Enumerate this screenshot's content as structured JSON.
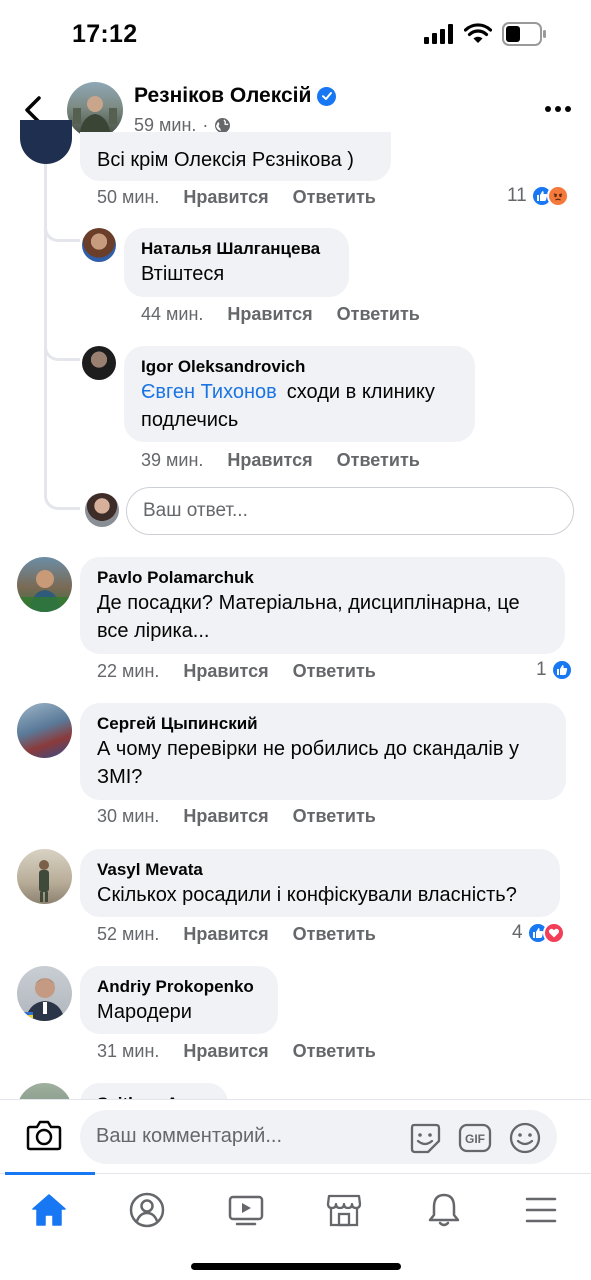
{
  "status_bar": {
    "time": "17:12"
  },
  "header": {
    "name": "Резніков Олексій",
    "time_ago": "59 мин.",
    "separator": "·"
  },
  "comments": [
    {
      "text": "Всі крім Олексія Рєзнікова )",
      "time": "50 мин.",
      "like_label": "Нравится",
      "reply_label": "Ответить",
      "reaction_count": "11",
      "reactions": [
        "like",
        "angry"
      ]
    },
    {
      "author": "Наталья Шалганцева",
      "text": "Втіштеся",
      "time": "44 мин.",
      "like_label": "Нравится",
      "reply_label": "Ответить"
    },
    {
      "author": "Igor Oleksandrovich",
      "mention": "Євген Тихонов",
      "text_line1": "сходи в клинику",
      "text_line2": "подлечись",
      "time": "39 мин.",
      "like_label": "Нравится",
      "reply_label": "Ответить"
    },
    {
      "author": "Pavlo Polamarchuk",
      "text_line1": "Де посадки? Матеріальна, дисциплінарна, це",
      "text_line2": "все лірика...",
      "time": "22 мин.",
      "like_label": "Нравится",
      "reply_label": "Ответить",
      "reaction_count": "1",
      "reactions": [
        "like"
      ]
    },
    {
      "author": "Сергей Цыпинский",
      "text_line1": "А чому перевірки не робились до скандалів у",
      "text_line2": "ЗМІ?",
      "time": "30 мин.",
      "like_label": "Нравится",
      "reply_label": "Ответить"
    },
    {
      "author": "Vasyl Mevata",
      "text": "Скількох росадили і конфіскували власність?",
      "time": "52 мин.",
      "like_label": "Нравится",
      "reply_label": "Ответить",
      "reaction_count": "4",
      "reactions": [
        "like",
        "love"
      ]
    },
    {
      "author": "Andriy Prokopenko",
      "text": "Мародери",
      "time": "31 мин.",
      "like_label": "Нравится",
      "reply_label": "Ответить"
    },
    {
      "author": "Svitlana A..."
    }
  ],
  "reply_input": {
    "placeholder": "Ваш ответ..."
  },
  "composer": {
    "placeholder": "Ваш комментарий..."
  },
  "tabs": [
    "home-icon",
    "profile-icon",
    "video-icon",
    "marketplace-icon",
    "notifications-icon",
    "menu-icon"
  ],
  "colors": {
    "accent": "#1877f2",
    "bubble": "#f0f2f5",
    "meta_text": "#65676b"
  }
}
